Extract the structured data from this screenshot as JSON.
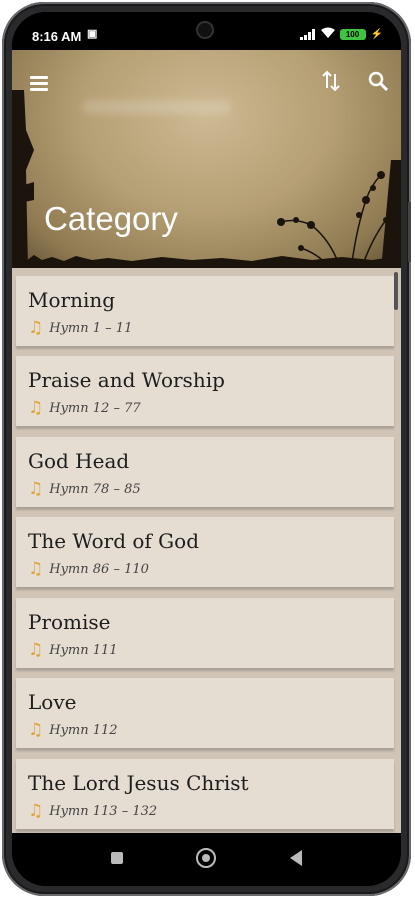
{
  "status": {
    "time": "8:16 AM",
    "sim_icon": "sim-icon",
    "battery": "100"
  },
  "header": {
    "title": "Category",
    "icons": [
      "menu-icon",
      "sort-icon",
      "search-icon"
    ]
  },
  "categories": [
    {
      "title": "Morning",
      "range": "Hymn 1 – 11"
    },
    {
      "title": "Praise and Worship",
      "range": "Hymn 12 – 77"
    },
    {
      "title": "God Head",
      "range": "Hymn 78 – 85"
    },
    {
      "title": "The Word of God",
      "range": "Hymn 86 – 110"
    },
    {
      "title": "Promise",
      "range": "Hymn 111"
    },
    {
      "title": "Love",
      "range": "Hymn 112"
    },
    {
      "title": "The Lord Jesus Christ",
      "range": "Hymn 113 – 132"
    }
  ],
  "colors": {
    "accent_note": "#e1a23a",
    "card_bg": "#e5ddd2",
    "list_bg": "#cfc4b6"
  }
}
